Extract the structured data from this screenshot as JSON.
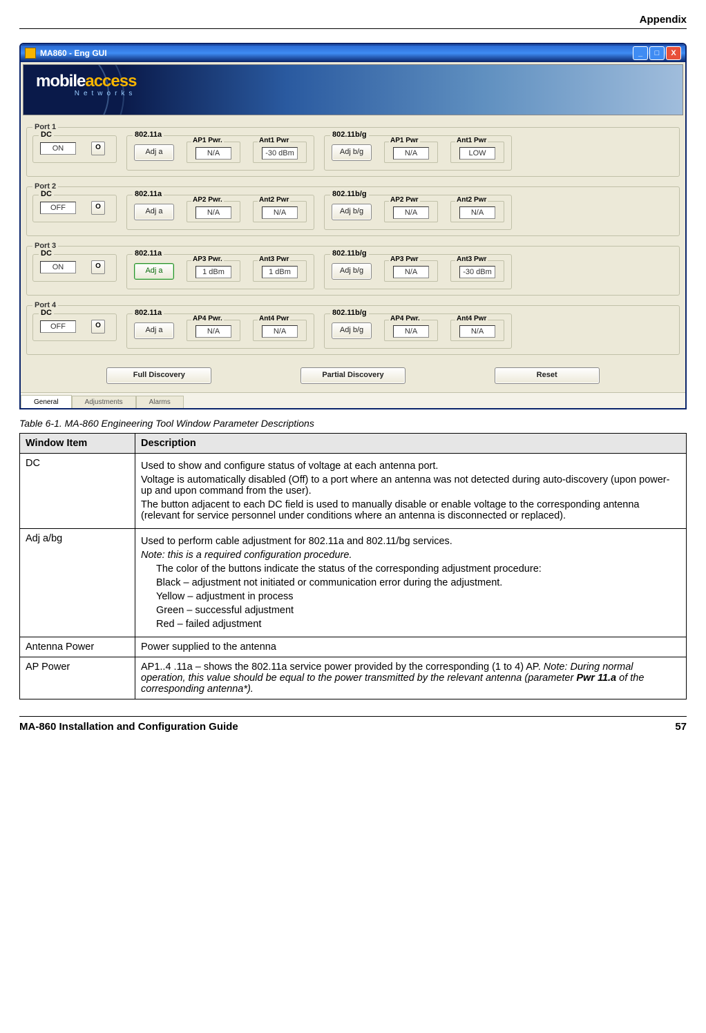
{
  "header": {
    "title": "Appendix"
  },
  "window": {
    "title": "MA860 - Eng GUI",
    "logo_main": "mobile",
    "logo_accent": "access",
    "logo_sub": "Networks",
    "buttons": {
      "min": "_",
      "max": "□",
      "close": "X"
    },
    "big_buttons": {
      "full": "Full Discovery",
      "partial": "Partial Discovery",
      "reset": "Reset"
    },
    "tabs": [
      "General",
      "Adjustments",
      "Alarms"
    ],
    "ports": [
      {
        "legend": "Port 1",
        "dc_legend": "DC",
        "dc_value": "ON",
        "dc_btn": "O",
        "a_legend": "802.11a",
        "adj_a": "Adj  a",
        "ap_a_legend": "AP1 Pwr.",
        "ap_a_val": "N/A",
        "ant_a_legend": "Ant1 Pwr",
        "ant_a_val": "-30 dBm",
        "bg_legend": "802.11b/g",
        "adj_bg": "Adj b/g",
        "ap_bg_legend": "AP1 Pwr",
        "ap_bg_val": "N/A",
        "ant_bg_legend": "Ant1 Pwr",
        "ant_bg_val": "LOW"
      },
      {
        "legend": "Port 2",
        "dc_legend": "DC",
        "dc_value": "OFF",
        "dc_btn": "O",
        "a_legend": "802.11a",
        "adj_a": "Adj  a",
        "ap_a_legend": "AP2 Pwr.",
        "ap_a_val": "N/A",
        "ant_a_legend": "Ant2 Pwr",
        "ant_a_val": "N/A",
        "bg_legend": "802.11b/g",
        "adj_bg": "Adj b/g",
        "ap_bg_legend": "AP2 Pwr",
        "ap_bg_val": "N/A",
        "ant_bg_legend": "Ant2 Pwr",
        "ant_bg_val": "N/A"
      },
      {
        "legend": "Port 3",
        "dc_legend": "DC",
        "dc_value": "ON",
        "dc_btn": "O",
        "a_legend": "802.11a",
        "adj_a": "Adj  a",
        "adj_a_green": true,
        "ap_a_legend": "AP3 Pwr.",
        "ap_a_val": "1 dBm",
        "ant_a_legend": "Ant3 Pwr",
        "ant_a_val": "1 dBm",
        "bg_legend": "802.11b/g",
        "adj_bg": "Adj b/g",
        "ap_bg_legend": "AP3 Pwr",
        "ap_bg_val": "N/A",
        "ant_bg_legend": "Ant3 Pwr",
        "ant_bg_val": "-30 dBm"
      },
      {
        "legend": "Port 4",
        "dc_legend": "DC",
        "dc_value": "OFF",
        "dc_btn": "O",
        "a_legend": "802.11a",
        "adj_a": "Adj  a",
        "ap_a_legend": "AP4 Pwr.",
        "ap_a_val": "N/A",
        "ant_a_legend": "Ant4 Pwr",
        "ant_a_val": "N/A",
        "bg_legend": "802.11b/g",
        "adj_bg": "Adj b/g",
        "ap_bg_legend": "AP4 Pwr.",
        "ap_bg_val": "N/A",
        "ant_bg_legend": "Ant4 Pwr",
        "ant_bg_val": "N/A"
      }
    ]
  },
  "caption": "Table 6-1. MA-860 Engineering Tool Window Parameter Descriptions",
  "table": {
    "head": [
      "Window Item",
      "Description"
    ],
    "rows": [
      {
        "item": "DC",
        "desc": [
          "Used to show and configure status of voltage at each antenna port.",
          "Voltage is automatically disabled (Off) to a port where an antenna was not detected during auto-discovery (upon power-up and upon command from the user).",
          "The button adjacent to each DC field is used to manually disable or enable voltage to the corresponding antenna (relevant for service personnel under conditions where an antenna is disconnected or replaced)."
        ]
      },
      {
        "item": "Adj a/bg",
        "desc_line1": "Used to perform cable adjustment for 802.11a and 802.11/bg services.",
        "note": "Note: this is a required configuration procedure.",
        "indent": [
          "The color of the buttons indicate the status of the corresponding adjustment procedure:",
          "Black – adjustment not initiated or communication error during the adjustment.",
          "Yellow – adjustment in process",
          "Green – successful adjustment",
          "Red – failed adjustment"
        ]
      },
      {
        "item": "Antenna Power",
        "desc_single": "Power supplied to the antenna"
      },
      {
        "item": "AP Power",
        "ap_pre": "AP1..4 .11a – shows the 802.11a service power provided by the corresponding (1 to 4) AP.  ",
        "ap_note": "Note: During normal operation, this value should be equal to the power transmitted by the relevant antenna (parameter ",
        "ap_bold": "Pwr 11.a",
        "ap_tail": " of the corresponding antenna*)."
      }
    ]
  },
  "footer": {
    "left": "MA-860 Installation and Configuration Guide",
    "right": "57"
  }
}
